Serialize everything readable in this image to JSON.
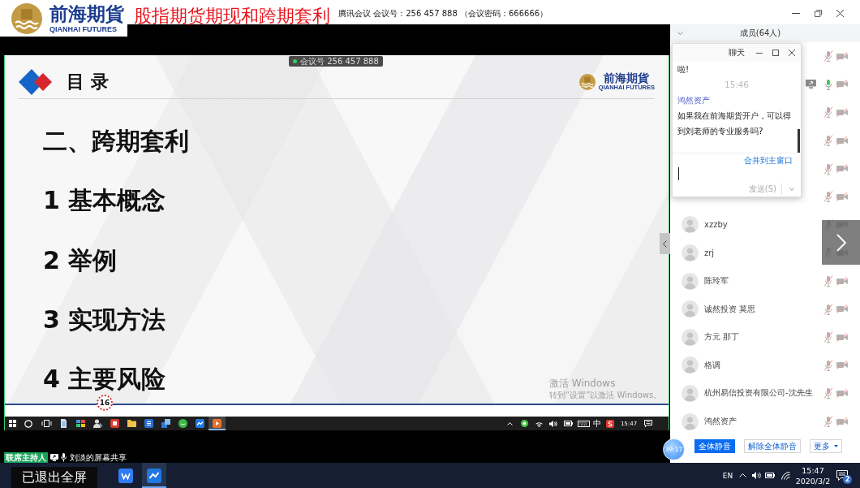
{
  "window": {
    "meeting_info": "腾讯会议 会议号：256 457 888 （会议密码：666666）"
  },
  "banner": {
    "logo_name": "前海期貨",
    "logo_subtitle": "QIANHAI FUTURES",
    "title": "股指期货期现和跨期套利"
  },
  "shared_screen": {
    "meeting_badge": "会议号 256 457 888",
    "slide": {
      "heading": "目 录",
      "logo_name": "前海期貨",
      "logo_subtitle": "QIANHAI FUTURES",
      "items": [
        "二、跨期套利",
        "1 基本概念",
        "2 举例",
        "3 实现方法",
        "4 主要风险"
      ],
      "page_number": "16",
      "activation_notice": {
        "title": "激活 Windows",
        "hint": "转到“设置”以激活 Windows。"
      }
    },
    "taskbar": {
      "apps": [
        {
          "kind": "notes",
          "active": false
        },
        {
          "kind": "palette",
          "active": false
        },
        {
          "kind": "person",
          "active": false
        },
        {
          "kind": "writer",
          "active": false
        },
        {
          "kind": "folder",
          "active": false
        },
        {
          "kind": "word",
          "active": false
        },
        {
          "kind": "windows",
          "active": false
        },
        {
          "kind": "chat",
          "active": false
        },
        {
          "kind": "meeting",
          "active": false
        },
        {
          "kind": "slides",
          "active": true
        }
      ],
      "input_method": "中",
      "time": "15:47"
    }
  },
  "presenter": {
    "role": "联席主持人",
    "sharing_label": "刘淡的屏幕共享"
  },
  "members_panel": {
    "title": "成员(64人)",
    "members": [
      {
        "mic_on": false,
        "camera_on": false,
        "sharing": false
      },
      {
        "mic_on": true,
        "camera_on": false,
        "sharing": true
      },
      {
        "mic_on": false,
        "camera_on": false,
        "sharing": false
      },
      {
        "mic_on": false,
        "camera_on": false,
        "sharing": false
      },
      {
        "mic_on": false,
        "camera_on": false,
        "sharing": false
      },
      {
        "mic_on": false,
        "camera_on": false,
        "sharing": false
      },
      {
        "name": "xzzby",
        "mic_on": false,
        "camera_on": false,
        "sharing": false
      },
      {
        "name": "zrj",
        "mic_on": false,
        "camera_on": false,
        "sharing": false
      },
      {
        "name": "陈玲军",
        "mic_on": false,
        "camera_on": false,
        "sharing": false
      },
      {
        "name": "诚然投资 莫思",
        "mic_on": false,
        "camera_on": false,
        "sharing": false
      },
      {
        "name": "方元 那丁",
        "mic_on": false,
        "camera_on": false,
        "sharing": false
      },
      {
        "name": "格调",
        "mic_on": false,
        "camera_on": false,
        "sharing": false
      },
      {
        "name": "杭州易信投资有限公司-沈先生",
        "mic_on": false,
        "camera_on": false,
        "sharing": false
      },
      {
        "name": "鸿然资产",
        "mic_on": false,
        "camera_on": false,
        "sharing": false
      }
    ],
    "timer": "39:17",
    "buttons": [
      {
        "label": "全体静音",
        "kind": "primary"
      },
      {
        "label": "解除全体静音",
        "kind": "plain"
      },
      {
        "label": "更多",
        "kind": "menu"
      }
    ]
  },
  "chat": {
    "title": "聊天",
    "messages": [
      {
        "kind": "text",
        "text": "啦!"
      },
      {
        "kind": "time",
        "text": "15:46"
      },
      {
        "kind": "sender",
        "text": "鸿然资产"
      },
      {
        "kind": "text",
        "text": "如果我在前海期货开户，可以得到刘老师的专业服务吗?"
      }
    ],
    "merge_link": "合并到主窗口",
    "send_button": "发送(S)"
  },
  "host_taskbar": {
    "notice": "已退出全屏",
    "apps": [
      {
        "kind": "wps",
        "active": false
      },
      {
        "kind": "meeting",
        "active": true
      }
    ],
    "language": "EN",
    "time": "15:47",
    "date": "2020/3/2",
    "notification_count": "2"
  }
}
